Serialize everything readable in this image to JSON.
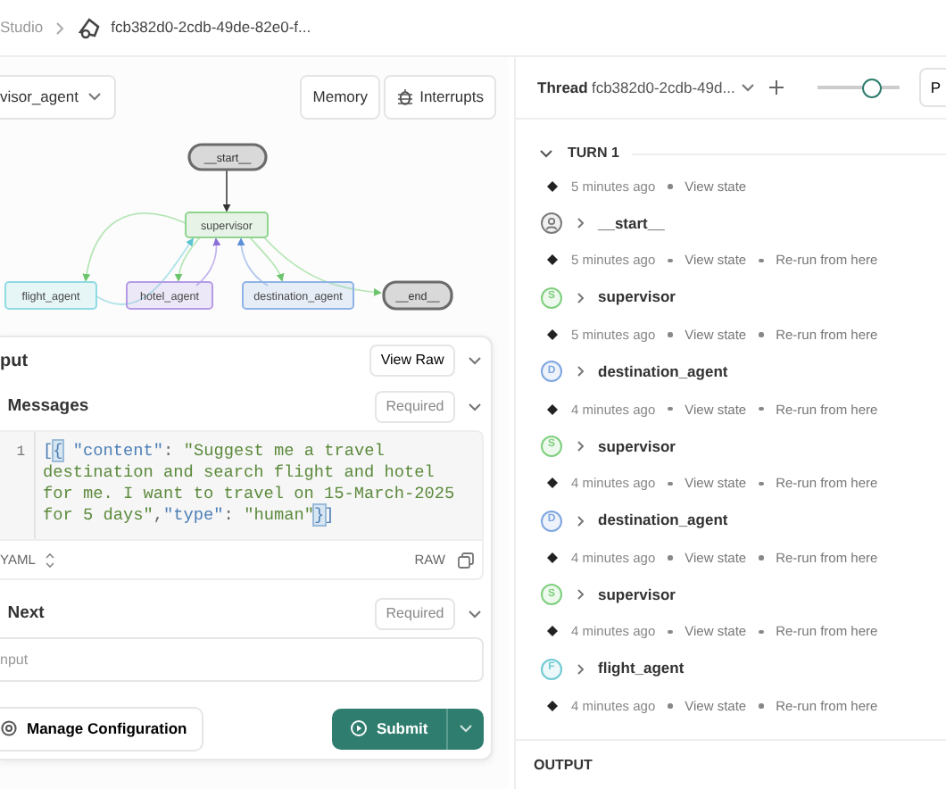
{
  "breadcrumb": {
    "parent": "Studio",
    "title": "fcb382d0-2cdb-49de-82e0-f..."
  },
  "graph_panel": {
    "graph_selector": "visor_agent",
    "buttons": [
      {
        "label": "Memory",
        "kind": "plain"
      },
      {
        "label": "Interrupts",
        "kind": "bug"
      }
    ],
    "nodes": [
      {
        "label": "__start__",
        "kind": "terminal",
        "color": "#6b6b6b"
      },
      {
        "label": "supervisor",
        "kind": "agent",
        "color": "#8fd48f"
      },
      {
        "label": "flight_agent",
        "kind": "agent",
        "color": "#8fdbe3"
      },
      {
        "label": "hotel_agent",
        "kind": "agent",
        "color": "#b49be6"
      },
      {
        "label": "destination_agent",
        "kind": "agent",
        "color": "#8fb3e6"
      },
      {
        "label": "__end__",
        "kind": "terminal",
        "color": "#6b6b6b"
      }
    ]
  },
  "input": {
    "title": "put",
    "view_raw": "View Raw",
    "fields": [
      {
        "label": "Messages",
        "badge": "Required",
        "kind": "code",
        "line_numbers": [
          "1"
        ],
        "code": [
          {
            "text": "[",
            "kind": "punct"
          },
          {
            "text": "{",
            "kind": "match"
          },
          {
            "text": " \"content\"",
            "kind": "key"
          },
          {
            "text": ": ",
            "kind": "plain"
          },
          {
            "text": "\"Suggest me a travel destination and search flight and hotel for me. I want to travel on 15-March-2025 for 5 days\"",
            "kind": "string"
          },
          {
            "text": ",",
            "kind": "plain"
          },
          {
            "text": "\"type\"",
            "kind": "key"
          },
          {
            "text": ": ",
            "kind": "plain"
          },
          {
            "text": "\"human\"",
            "kind": "string"
          },
          {
            "text": "}",
            "kind": "match"
          },
          {
            "text": "]",
            "kind": "punct"
          }
        ],
        "format": "YAML",
        "raw": "RAW"
      },
      {
        "label": "Next",
        "badge": "Required",
        "kind": "text",
        "placeholder": "nput"
      }
    ],
    "manage_button": "Manage Configuration",
    "submit_button": "Submit"
  },
  "thread": {
    "label": "Thread",
    "id": "fcb382d0-2cdb-49d...",
    "level": 0.72,
    "cut_button": "P"
  },
  "turn": {
    "title": "TURN 1",
    "expanded": true,
    "events": [
      {
        "kind": "time",
        "time": "5 minutes ago",
        "links": [
          "View state"
        ]
      },
      {
        "kind": "start",
        "name": "__start__",
        "color": "#7a7a7a"
      },
      {
        "kind": "time",
        "time": "5 minutes ago",
        "links": [
          "View state",
          "Re-run from here"
        ]
      },
      {
        "kind": "node",
        "name": "supervisor",
        "avatar": "S",
        "color": "#7fcf7f"
      },
      {
        "kind": "time",
        "time": "5 minutes ago",
        "links": [
          "View state",
          "Re-run from here"
        ]
      },
      {
        "kind": "node",
        "name": "destination_agent",
        "avatar": "D",
        "color": "#7ea6e0"
      },
      {
        "kind": "time",
        "time": "4 minutes ago",
        "links": [
          "View state",
          "Re-run from here"
        ]
      },
      {
        "kind": "node",
        "name": "supervisor",
        "avatar": "S",
        "color": "#7fcf7f"
      },
      {
        "kind": "time",
        "time": "4 minutes ago",
        "links": [
          "View state",
          "Re-run from here"
        ]
      },
      {
        "kind": "node",
        "name": "destination_agent",
        "avatar": "D",
        "color": "#7ea6e0"
      },
      {
        "kind": "time",
        "time": "4 minutes ago",
        "links": [
          "View state",
          "Re-run from here"
        ]
      },
      {
        "kind": "node",
        "name": "supervisor",
        "avatar": "S",
        "color": "#7fcf7f"
      },
      {
        "kind": "time",
        "time": "4 minutes ago",
        "links": [
          "View state",
          "Re-run from here"
        ]
      },
      {
        "kind": "node",
        "name": "flight_agent",
        "avatar": "F",
        "color": "#6fcad4"
      },
      {
        "kind": "time",
        "time": "4 minutes ago",
        "links": [
          "View state",
          "Re-run from here"
        ]
      }
    ]
  },
  "output": {
    "title": "OUTPUT"
  }
}
